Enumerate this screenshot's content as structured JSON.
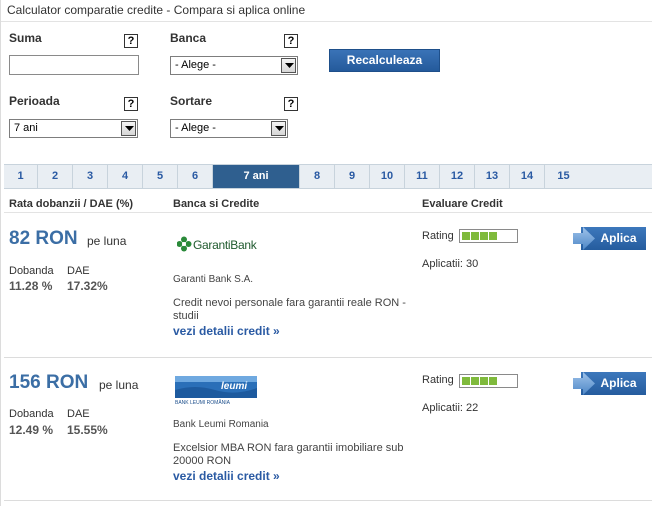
{
  "header": {
    "title": "Calculator comparatie credite - Compara si aplica online"
  },
  "form": {
    "suma_label": "Suma",
    "suma_value": "",
    "banca_label": "Banca",
    "banca_value": "- Alege -",
    "perioada_label": "Perioada",
    "perioada_value": "7 ani",
    "sortare_label": "Sortare",
    "sortare_value": "- Alege -",
    "help": "?",
    "recalc_label": "Recalculeaza"
  },
  "tabs": [
    "1",
    "2",
    "3",
    "4",
    "5",
    "6",
    "7 ani",
    "8",
    "9",
    "10",
    "11",
    "12",
    "13",
    "14",
    "15"
  ],
  "active_tab": "7 ani",
  "columns": {
    "rate": "Rata dobanzii / DAE (%)",
    "bank": "Banca si Credite",
    "eval": "Evaluare Credit"
  },
  "offers": [
    {
      "amount": "82 RON",
      "unit": "pe luna",
      "dobanda_label": "Dobanda",
      "dobanda_value": "11.28 %",
      "dae_label": "DAE",
      "dae_value": "17.32%",
      "bank_logo_text": "GarantiBank",
      "bank_name": "Garanti Bank S.A.",
      "description": "Credit nevoi personale fara garantii reale RON - studii",
      "details_link": "vezi detalii credit »",
      "rating_label": "Rating",
      "rating": 4,
      "rating_max": 6,
      "applications": "Aplicatii: 30",
      "apply_label": "Aplica"
    },
    {
      "amount": "156 RON",
      "unit": "pe luna",
      "dobanda_label": "Dobanda",
      "dobanda_value": "12.49 %",
      "dae_label": "DAE",
      "dae_value": "15.55%",
      "bank_logo_text": "leumi",
      "bank_logo_subtext": "BANK LEUMI ROMÂNIA",
      "bank_name": "Bank Leumi Romania",
      "description": "Excelsior MBA RON fara garantii imobiliare sub 20000 RON",
      "details_link": "vezi detalii credit »",
      "rating_label": "Rating",
      "rating": 4,
      "rating_max": 6,
      "applications": "Aplicatii: 22",
      "apply_label": "Aplica"
    }
  ],
  "colors": {
    "brand_blue": "#3b6ea5",
    "active_tab": "#2f5f8f",
    "rating_green": "#7fba3c"
  }
}
